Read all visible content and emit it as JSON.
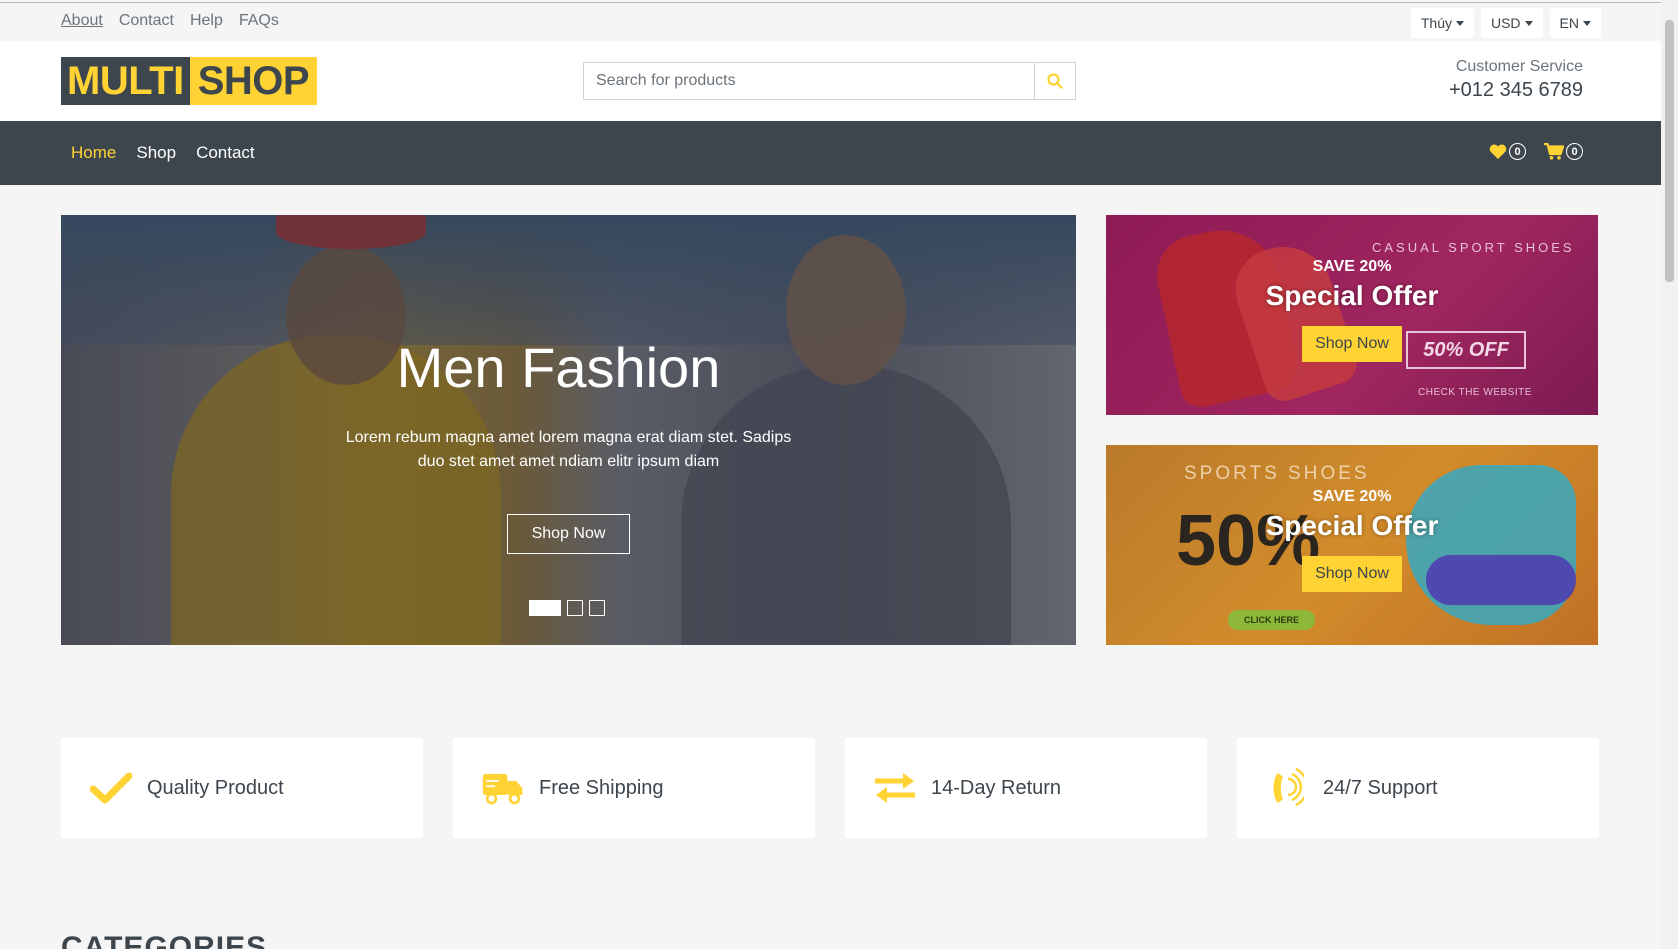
{
  "topbar": {
    "links": [
      "About",
      "Contact",
      "Help",
      "FAQs"
    ],
    "user_menu": "Thúy",
    "currency": "USD",
    "language": "EN"
  },
  "header": {
    "logo_part1": "MULTI",
    "logo_part2": "SHOP",
    "search_placeholder": "Search for products",
    "customer_service_label": "Customer Service",
    "phone": "+012 345 6789"
  },
  "nav": {
    "links": [
      "Home",
      "Shop",
      "Contact"
    ],
    "active": "Home",
    "wishlist_count": "0",
    "cart_count": "0"
  },
  "hero": {
    "title": "Men Fashion",
    "text": "Lorem rebum magna amet lorem magna erat diam stet. Sadips duo stet amet amet ndiam elitr ipsum diam",
    "button": "Shop Now",
    "slides": 3,
    "active_slide": 1
  },
  "offers": [
    {
      "save": "SAVE 20%",
      "title": "Special Offer",
      "button": "Shop Now",
      "banner_heading": "CASUAL SPORT SHOES",
      "banner_badge": "50% OFF",
      "banner_footer": "CHECK THE WEBSITE"
    },
    {
      "save": "SAVE 20%",
      "title": "Special Offer",
      "button": "Shop Now",
      "banner_heading": "SPORTS SHOES",
      "banner_big": "50%",
      "banner_footer": "CLICK HERE"
    }
  ],
  "features": [
    {
      "label": "Quality Product",
      "icon": "check-icon"
    },
    {
      "label": "Free Shipping",
      "icon": "shipping-truck-icon"
    },
    {
      "label": "14-Day Return",
      "icon": "exchange-arrows-icon"
    },
    {
      "label": "24/7 Support",
      "icon": "phone-volume-icon"
    }
  ],
  "section_title": "CATEGORIES",
  "colors": {
    "accent": "#ffd333",
    "dark": "#3d464d",
    "background": "#f5f5f5"
  }
}
